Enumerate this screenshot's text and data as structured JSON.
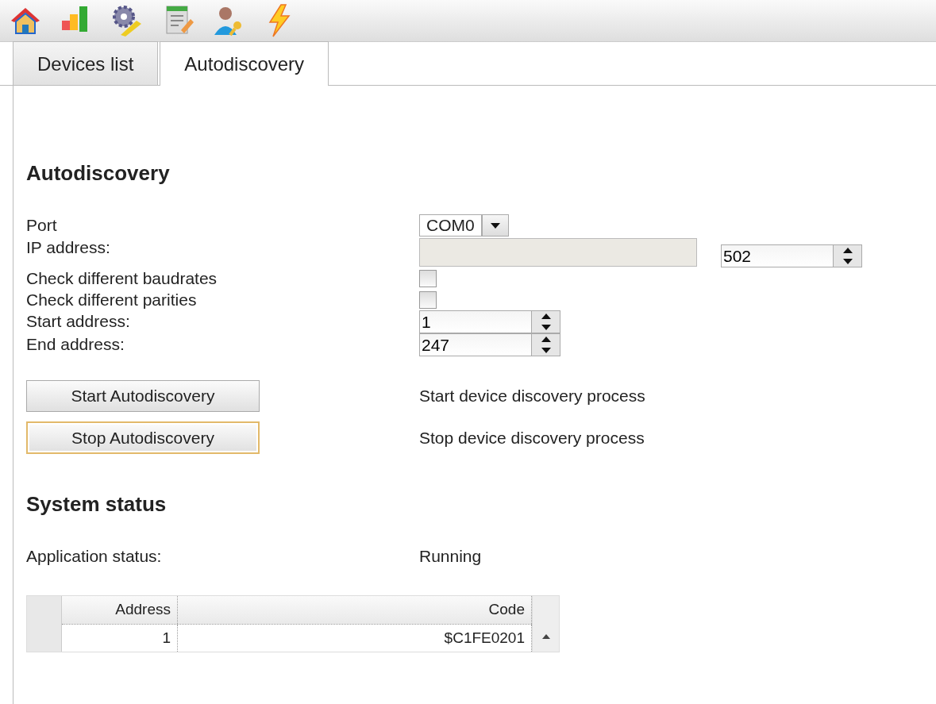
{
  "tabs": [
    {
      "label": "Devices list",
      "selected": false
    },
    {
      "label": "Autodiscovery",
      "selected": true
    }
  ],
  "autodiscovery": {
    "title": "Autodiscovery",
    "rows": [
      {
        "label": "Port",
        "kind": "select",
        "value": "COM0"
      },
      {
        "label": "IP address:",
        "kind": "ip",
        "disabled": true,
        "port": "502"
      },
      {
        "label": "Check different baudrates",
        "kind": "checkbox",
        "checked": false
      },
      {
        "label": "Check different parities",
        "kind": "checkbox",
        "checked": false
      },
      {
        "label": "Start address:",
        "kind": "spin",
        "value": "1"
      },
      {
        "label": "End address:",
        "kind": "spin",
        "value": "247"
      }
    ],
    "buttons": [
      {
        "label": "Start Autodiscovery",
        "description": "Start device discovery process",
        "focused": false
      },
      {
        "label": "Stop Autodiscovery",
        "description": "Stop device discovery process",
        "focused": true
      }
    ]
  },
  "system_status": {
    "title": "System status",
    "label": "Application status:",
    "value": "Running",
    "table": {
      "columns": [
        "Address",
        "Code"
      ],
      "rows": [
        [
          "1",
          "$C1FE0201"
        ]
      ]
    }
  }
}
